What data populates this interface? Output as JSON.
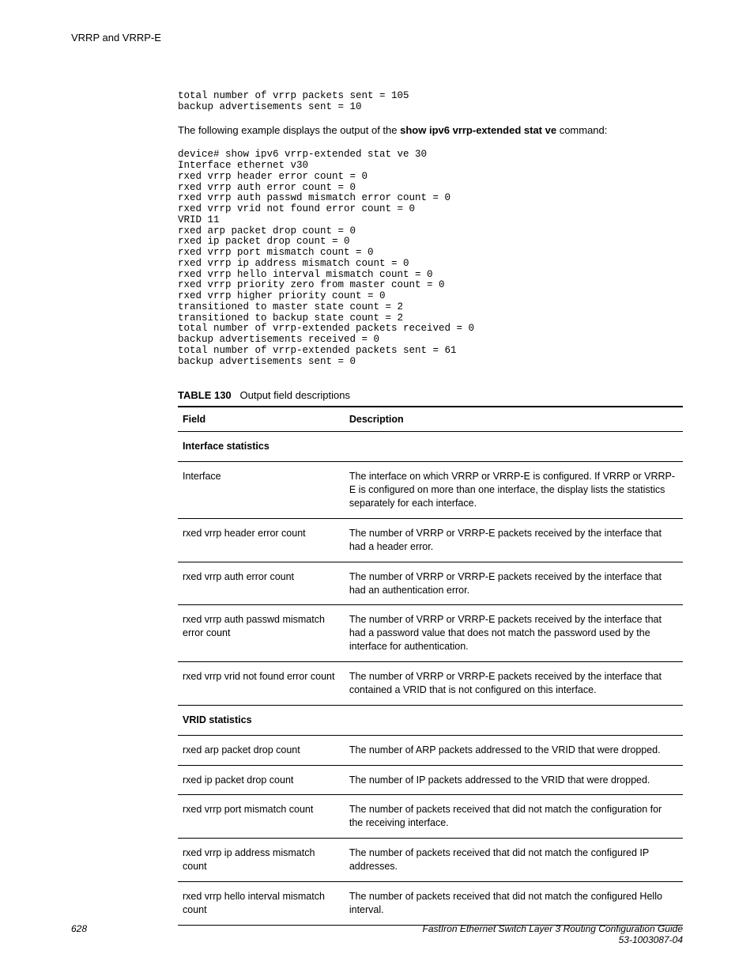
{
  "header": {
    "title": "VRRP and VRRP-E"
  },
  "snippet1": "total number of vrrp packets sent = 105\nbackup advertisements sent = 10",
  "intro": {
    "pre": "The following example displays the output of the ",
    "cmd": "show ipv6 vrrp-extended stat ve",
    "post": " command:"
  },
  "snippet2": "device# show ipv6 vrrp-extended stat ve 30\nInterface ethernet v30\nrxed vrrp header error count = 0\nrxed vrrp auth error count = 0\nrxed vrrp auth passwd mismatch error count = 0\nrxed vrrp vrid not found error count = 0\nVRID 11\nrxed arp packet drop count = 0\nrxed ip packet drop count = 0\nrxed vrrp port mismatch count = 0\nrxed vrrp ip address mismatch count = 0\nrxed vrrp hello interval mismatch count = 0\nrxed vrrp priority zero from master count = 0\nrxed vrrp higher priority count = 0\ntransitioned to master state count = 2\ntransitioned to backup state count = 2\ntotal number of vrrp-extended packets received = 0\nbackup advertisements received = 0\ntotal number of vrrp-extended packets sent = 61\nbackup advertisements sent = 0",
  "table": {
    "number": "TABLE 130",
    "caption": "Output field descriptions",
    "headers": {
      "field": "Field",
      "desc": "Description"
    },
    "rows": [
      {
        "field": "Interface statistics",
        "desc": "",
        "section": true
      },
      {
        "field": "Interface",
        "desc": "The interface on which VRRP or VRRP-E is configured. If VRRP or VRRP-E is configured on more than one interface, the display lists the statistics separately for each interface."
      },
      {
        "field": "rxed vrrp header error count",
        "desc": "The number of VRRP or VRRP-E packets received by the interface that had a header error."
      },
      {
        "field": "rxed vrrp auth error count",
        "desc": "The number of VRRP or VRRP-E packets received by the interface that had an authentication error."
      },
      {
        "field": "rxed vrrp auth passwd mismatch error count",
        "desc": "The number of VRRP or VRRP-E packets received by the interface that had a password value that does not match the password used by the interface for authentication."
      },
      {
        "field": "rxed vrrp vrid not found error count",
        "desc": "The number of VRRP or VRRP-E packets received by the interface that contained a VRID that is not configured on this interface."
      },
      {
        "field": "VRID statistics",
        "desc": "",
        "section": true
      },
      {
        "field": "rxed arp packet drop count",
        "desc": "The number of ARP packets addressed to the VRID that were dropped."
      },
      {
        "field": "rxed ip packet drop count",
        "desc": "The number of IP packets addressed to the VRID that were dropped."
      },
      {
        "field": "rxed vrrp port mismatch count",
        "desc": "The number of packets received that did not match the configuration for the receiving interface."
      },
      {
        "field": "rxed vrrp ip address mismatch count",
        "desc": "The number of packets received that did not match the configured IP addresses."
      },
      {
        "field": "rxed vrrp hello interval mismatch count",
        "desc": "The number of packets received that did not match the configured Hello interval."
      }
    ]
  },
  "footer": {
    "page": "628",
    "doc1": "FastIron Ethernet Switch Layer 3 Routing Configuration Guide",
    "doc2": "53-1003087-04"
  }
}
